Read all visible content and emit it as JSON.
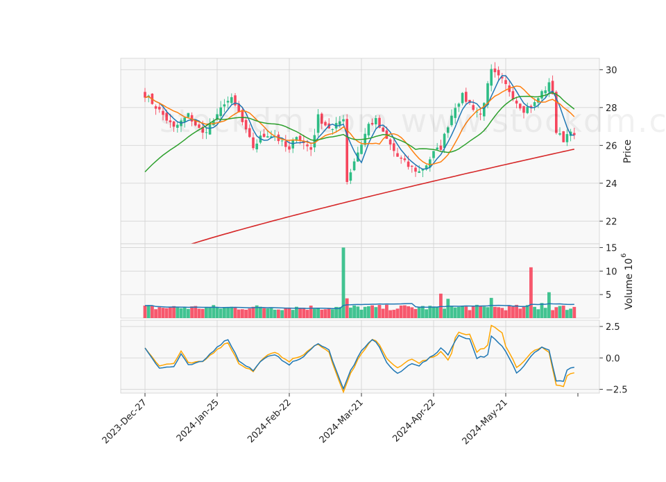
{
  "watermark": "stockdm.com www.stockdm.com",
  "chart_data": {
    "type": "candlestick",
    "grid": true,
    "x_axis": {
      "tick_labels": [
        "2023-Dec-27",
        "2024-Jan-25",
        "2024-Feb-22",
        "2024-Mar-21",
        "2024-Apr-22",
        "2024-May-21"
      ],
      "tick_index": [
        0,
        20,
        40,
        60,
        80,
        100
      ],
      "n_bars": 120
    },
    "price": {
      "ylabel": "Price",
      "ylim": [
        20.8,
        30.6
      ],
      "yticks": [
        22,
        24,
        26,
        28,
        30
      ],
      "up_color": "#2ebd85",
      "down_color": "#f6465d",
      "closes_anchor": [
        [
          0,
          28.7
        ],
        [
          5,
          27.6
        ],
        [
          8,
          26.9
        ],
        [
          12,
          27.6
        ],
        [
          14,
          27.1
        ],
        [
          16,
          26.6
        ],
        [
          18,
          27.1
        ],
        [
          20,
          27.5
        ],
        [
          22,
          28.3
        ],
        [
          24,
          28.4
        ],
        [
          26,
          27.7
        ],
        [
          28,
          26.7
        ],
        [
          30,
          25.9
        ],
        [
          32,
          26.4
        ],
        [
          34,
          26.6
        ],
        [
          36,
          26.5
        ],
        [
          40,
          25.7
        ],
        [
          42,
          26.6
        ],
        [
          44,
          26.1
        ],
        [
          46,
          25.8
        ],
        [
          48,
          27.5
        ],
        [
          50,
          27.1
        ],
        [
          52,
          26.8
        ],
        [
          55,
          27.5
        ],
        [
          56,
          24.1
        ],
        [
          58,
          25.2
        ],
        [
          60,
          26.1
        ],
        [
          62,
          27.1
        ],
        [
          64,
          27.3
        ],
        [
          66,
          26.6
        ],
        [
          68,
          26.0
        ],
        [
          70,
          25.4
        ],
        [
          73,
          24.9
        ],
        [
          76,
          24.6
        ],
        [
          78,
          25.0
        ],
        [
          80,
          25.6
        ],
        [
          82,
          25.9
        ],
        [
          84,
          27.1
        ],
        [
          86,
          28.1
        ],
        [
          88,
          28.6
        ],
        [
          90,
          28.2
        ],
        [
          93,
          27.6
        ],
        [
          96,
          29.9
        ],
        [
          99,
          29.4
        ],
        [
          101,
          28.9
        ],
        [
          103,
          28.3
        ],
        [
          105,
          27.9
        ],
        [
          108,
          28.2
        ],
        [
          110,
          28.8
        ],
        [
          112,
          29.2
        ],
        [
          113,
          28.8
        ],
        [
          114,
          26.7
        ],
        [
          116,
          26.3
        ],
        [
          118,
          26.9
        ],
        [
          119,
          26.4
        ]
      ],
      "ma_short": {
        "color": "#1f77b4"
      },
      "ma_mid": {
        "color": "#ff7f0e"
      },
      "ma_long": {
        "color": "#2ca02c"
      },
      "ma_trend": {
        "color": "#d62728",
        "start": 19.9,
        "end": 25.8
      }
    },
    "volume": {
      "ylabel": "Volume  10",
      "exponent": "6",
      "ylim": [
        0,
        15.8
      ],
      "yticks": [
        5,
        10,
        15
      ],
      "baseline": 2.0,
      "spikes": [
        [
          55,
          15.0
        ],
        [
          56,
          4.2
        ],
        [
          82,
          5.2
        ],
        [
          84,
          4.1
        ],
        [
          96,
          4.3
        ],
        [
          107,
          10.8
        ],
        [
          112,
          5.5
        ],
        [
          110,
          3.2
        ]
      ],
      "avg_color": "#1f77b4"
    },
    "oscillator": {
      "ylim": [
        -2.8,
        3.0
      ],
      "yticks": [
        -2.5,
        0.0,
        2.5
      ],
      "line1_color": "#1f77b4",
      "line2_color": "#ffa500",
      "anchors": [
        [
          0,
          0.8
        ],
        [
          4,
          -0.8
        ],
        [
          8,
          -0.7
        ],
        [
          10,
          0.3
        ],
        [
          12,
          -0.6
        ],
        [
          16,
          -0.3
        ],
        [
          20,
          0.9
        ],
        [
          23,
          1.5
        ],
        [
          26,
          -0.2
        ],
        [
          30,
          -1.0
        ],
        [
          33,
          0.0
        ],
        [
          36,
          0.2
        ],
        [
          40,
          -0.5
        ],
        [
          44,
          0.1
        ],
        [
          48,
          1.2
        ],
        [
          51,
          0.6
        ],
        [
          55,
          -2.5
        ],
        [
          57,
          -1.0
        ],
        [
          60,
          0.5
        ],
        [
          63,
          1.5
        ],
        [
          65,
          0.9
        ],
        [
          67,
          -0.4
        ],
        [
          70,
          -1.3
        ],
        [
          74,
          -0.4
        ],
        [
          76,
          -0.6
        ],
        [
          80,
          0.2
        ],
        [
          82,
          0.8
        ],
        [
          84,
          0.3
        ],
        [
          87,
          1.8
        ],
        [
          90,
          1.5
        ],
        [
          92,
          0.0
        ],
        [
          95,
          0.2
        ],
        [
          96,
          1.7
        ],
        [
          99,
          0.9
        ],
        [
          101,
          0.0
        ],
        [
          103,
          -1.2
        ],
        [
          105,
          -0.6
        ],
        [
          107,
          0.2
        ],
        [
          110,
          0.9
        ],
        [
          112,
          0.6
        ],
        [
          114,
          -1.8
        ],
        [
          116,
          -1.9
        ],
        [
          117,
          -1.0
        ],
        [
          119,
          -0.7
        ],
        [
          120,
          -0.9
        ]
      ]
    }
  }
}
